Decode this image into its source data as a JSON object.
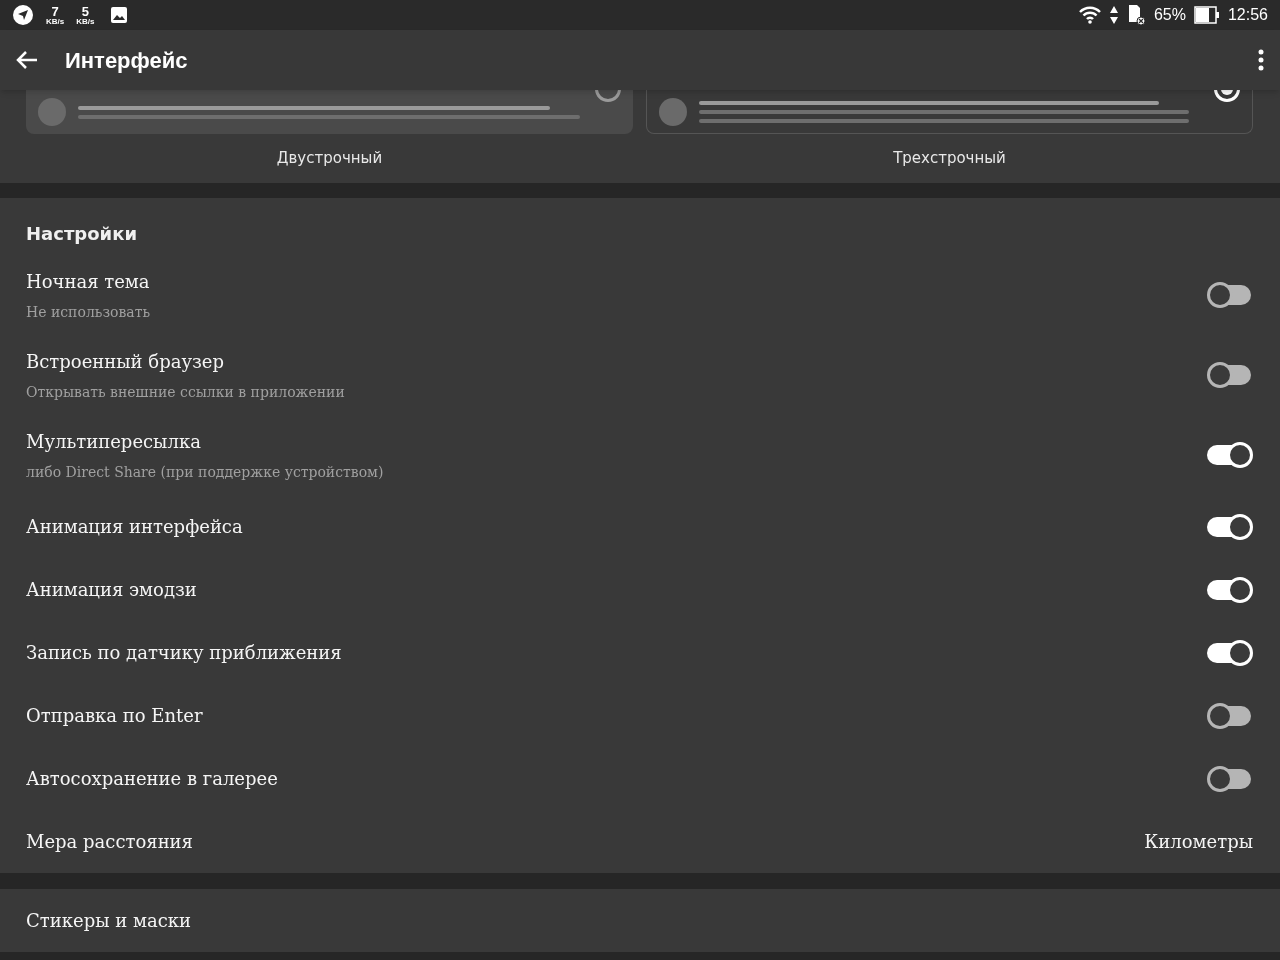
{
  "status_bar": {
    "speeds": [
      {
        "value": "7",
        "unit": "KB/s"
      },
      {
        "value": "5",
        "unit": "KB/s"
      }
    ],
    "battery": "65%",
    "time": "12:56"
  },
  "toolbar": {
    "title": "Интерфейс"
  },
  "layouts": [
    {
      "label": "Двустрочный",
      "kind": "two_line",
      "selected": false
    },
    {
      "label": "Трехстрочный",
      "kind": "three_line",
      "selected": true
    }
  ],
  "settings": {
    "header": "Настройки",
    "items": [
      {
        "kind": "switch",
        "title": "Ночная тема",
        "subtitle": "Не использовать",
        "on": false
      },
      {
        "kind": "switch",
        "title": "Встроенный браузер",
        "subtitle": "Открывать внешние ссылки в приложении",
        "on": false
      },
      {
        "kind": "switch",
        "title": "Мультипересылка",
        "subtitle": "либо Direct Share (при поддержке устройством)",
        "on": true
      },
      {
        "kind": "switch",
        "title": "Анимация интерфейса",
        "on": true
      },
      {
        "kind": "switch",
        "title": "Анимация эмодзи",
        "on": true
      },
      {
        "kind": "switch",
        "title": "Запись по датчику приближения",
        "on": true
      },
      {
        "kind": "switch",
        "title": "Отправка по Enter",
        "on": false
      },
      {
        "kind": "switch",
        "title": "Автосохранение в галерее",
        "on": false
      },
      {
        "kind": "value",
        "title": "Мера расстояния",
        "value": "Километры"
      }
    ]
  },
  "stickers": {
    "title": "Стикеры и маски"
  }
}
